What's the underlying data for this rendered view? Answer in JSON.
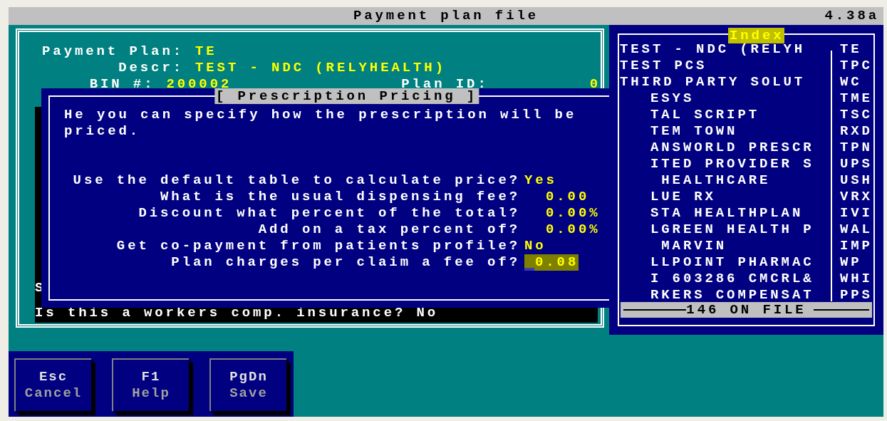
{
  "window": {
    "title": "Payment plan file",
    "version": "4.38a"
  },
  "plan": {
    "fields": [
      {
        "label": "Payment Plan:",
        "value": "TE"
      },
      {
        "label": "Descr:",
        "value": "TEST - NDC (RELYHEALTH)"
      },
      {
        "label": "BIN #:",
        "value": "200002"
      }
    ],
    "plan_id": {
      "label": "Plan ID:",
      "value": "0"
    },
    "partial_text": "S",
    "workers_comp": "Is this a workers comp. insurance? No"
  },
  "dialog": {
    "title": "[ Prescription Pricing ]",
    "intro": "He you can specify how the prescription will be priced.",
    "questions": [
      {
        "label": "Use the default table to calculate price?",
        "value": "Yes",
        "kind": "toggle",
        "focused": false
      },
      {
        "label": "What is the usual dispensing fee?",
        "value": "0.00",
        "kind": "amount",
        "focused": false
      },
      {
        "label": "Discount what percent of the total?",
        "value": "0.00%",
        "kind": "amount",
        "focused": false
      },
      {
        "label": "Add on a tax percent of?",
        "value": "0.00%",
        "kind": "amount",
        "focused": false
      },
      {
        "label": "Get co-payment from patients profile?",
        "value": "No",
        "kind": "toggle",
        "focused": false
      },
      {
        "label": "Plan charges per claim a fee of?",
        "value": "0.08",
        "kind": "amount",
        "focused": true
      }
    ]
  },
  "index": {
    "title": "Index",
    "footer": "146 ON FILE",
    "items": [
      {
        "name": "TEST - NDC (RELYH",
        "code": "TE",
        "clipped": false
      },
      {
        "name": "TEST PCS",
        "code": "TPC",
        "clipped": false
      },
      {
        "name": "THIRD PARTY SOLUT",
        "code": "WC",
        "clipped": false
      },
      {
        "name": "ESYS",
        "code": "TME",
        "clipped": true
      },
      {
        "name": "TAL SCRIPT",
        "code": "TSC",
        "clipped": true
      },
      {
        "name": "TEM TOWN",
        "code": "RXD",
        "clipped": true
      },
      {
        "name": "ANSWORLD PRESCR",
        "code": "TPN",
        "clipped": true
      },
      {
        "name": "ITED PROVIDER S",
        "code": "UPS",
        "clipped": true
      },
      {
        "name": " HEALTHCARE",
        "code": "USH",
        "clipped": true
      },
      {
        "name": "LUE RX",
        "code": "VRX",
        "clipped": true
      },
      {
        "name": "STA HEALTHPLAN",
        "code": "IVI",
        "clipped": true
      },
      {
        "name": "LGREEN HEALTH P",
        "code": "WAL",
        "clipped": true
      },
      {
        "name": " MARVIN",
        "code": "IMP",
        "clipped": true
      },
      {
        "name": "LLPOINT PHARMAC",
        "code": "WP",
        "clipped": true
      },
      {
        "name": "I 603286 CMCRL&",
        "code": "WHI",
        "clipped": true
      },
      {
        "name": "RKERS COMPENSAT",
        "code": "PPS",
        "clipped": true
      }
    ]
  },
  "buttons": [
    {
      "key": "Esc",
      "action": "Cancel"
    },
    {
      "key": "F1",
      "action": "Help"
    },
    {
      "key": "PgDn",
      "action": "Save"
    }
  ]
}
